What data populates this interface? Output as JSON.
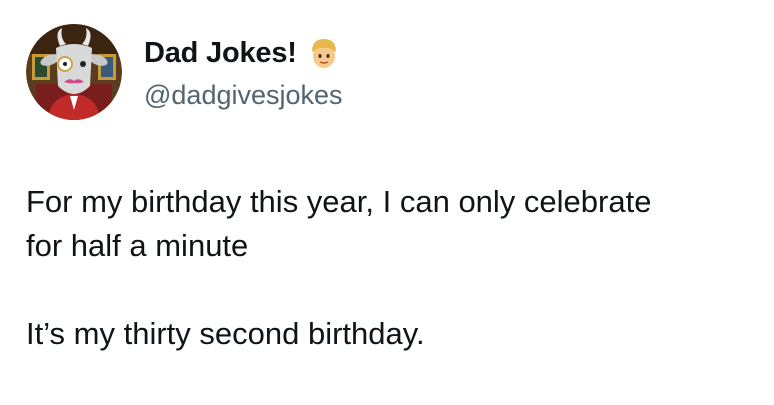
{
  "author": {
    "display_name": "Dad Jokes!",
    "handle": "@dadgivesjokes",
    "avatar_icon": "goat-with-monocle-avatar",
    "badge_icon": "man-blond-hair-emoji"
  },
  "tweet": {
    "paragraphs": [
      {
        "lines": [
          "For my birthday this year, I can only celebrate",
          "for half a minute"
        ]
      },
      {
        "lines": [
          "It’s my thirty second birthday."
        ]
      }
    ]
  },
  "colors": {
    "text": "#0f1419",
    "handle": "#536471",
    "background": "#ffffff"
  }
}
